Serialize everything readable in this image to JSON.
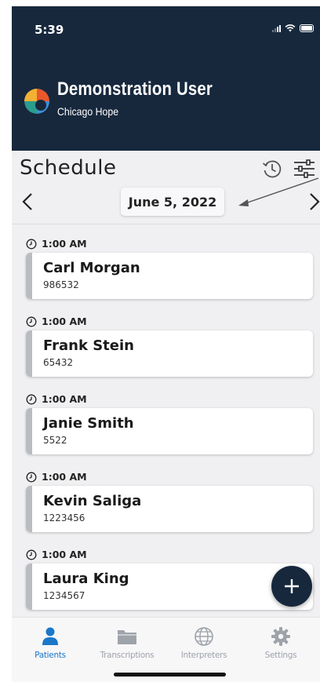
{
  "status_bar": {
    "time": "5:39"
  },
  "header": {
    "user_name": "Demonstration User",
    "organization": "Chicago Hope"
  },
  "schedule": {
    "title": "Schedule",
    "date": "June 5, 2022"
  },
  "appointments": [
    {
      "time": "1:00 AM",
      "name": "Carl Morgan",
      "id": "986532"
    },
    {
      "time": "1:00 AM",
      "name": "Frank Stein",
      "id": "65432"
    },
    {
      "time": "1:00 AM",
      "name": "Janie Smith",
      "id": "5522"
    },
    {
      "time": "1:00 AM",
      "name": "Kevin Saliga",
      "id": "1223456"
    },
    {
      "time": "1:00 AM",
      "name": "Laura King",
      "id": "1234567"
    }
  ],
  "tabs": [
    {
      "label": "Patients",
      "icon": "person-icon",
      "active": true
    },
    {
      "label": "Transcriptions",
      "icon": "folder-icon",
      "active": false
    },
    {
      "label": "Interpreters",
      "icon": "globe-icon",
      "active": false
    },
    {
      "label": "Settings",
      "icon": "gear-icon",
      "active": false
    }
  ],
  "colors": {
    "header_bg": "#17283d",
    "active_tab": "#1b77c8",
    "inactive_tab": "#9ea3aa",
    "card_stripe": "#b9bcc1"
  }
}
